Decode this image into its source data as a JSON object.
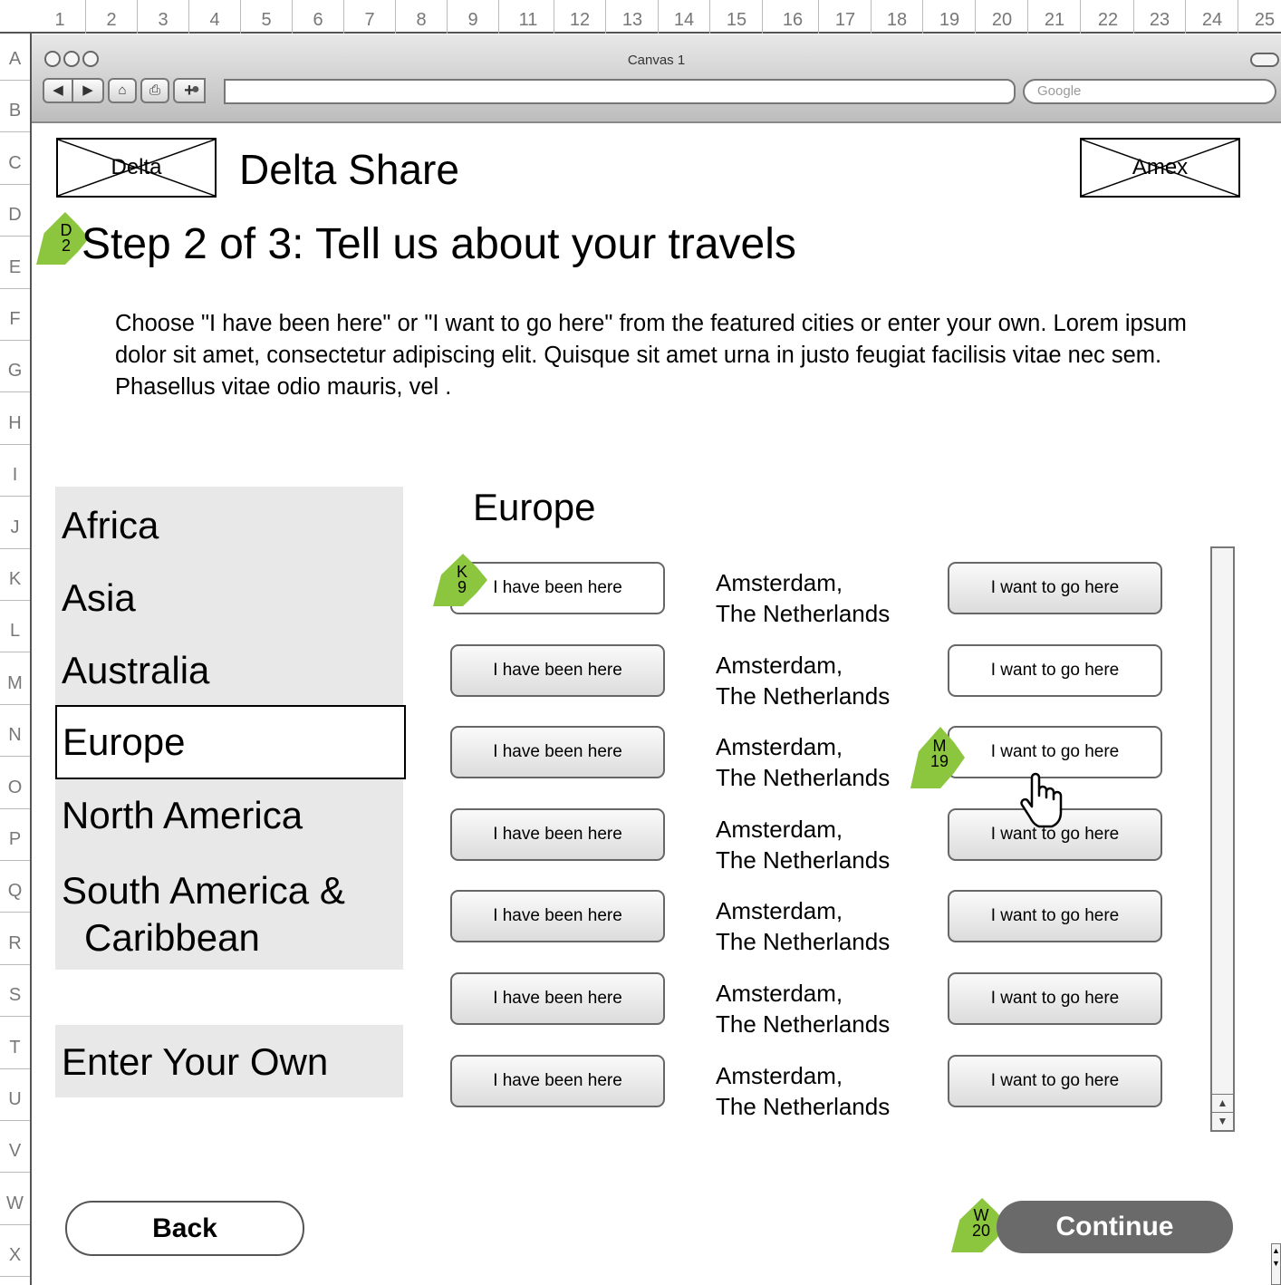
{
  "ruler": {
    "columns": [
      "1",
      "2",
      "3",
      "4",
      "5",
      "6",
      "7",
      "8",
      "9",
      "11",
      "12",
      "13",
      "14",
      "15",
      "16",
      "17",
      "18",
      "19",
      "20",
      "21",
      "22",
      "23",
      "24",
      "25"
    ],
    "rows": [
      "A",
      "B",
      "C",
      "D",
      "E",
      "F",
      "G",
      "H",
      "I",
      "J",
      "K",
      "L",
      "M",
      "N",
      "O",
      "P",
      "Q",
      "R",
      "S",
      "T",
      "U",
      "V",
      "W",
      "X"
    ]
  },
  "window": {
    "title": "Canvas 1",
    "search_placeholder": "Google",
    "nav": {
      "back_glyph": "◀",
      "forward_glyph": "▶",
      "home_glyph": "⌂",
      "print_glyph": "⎙",
      "add_glyph": "+",
      "globe_glyph": "●"
    }
  },
  "header": {
    "left_logo": "Delta",
    "site_title": "Delta Share",
    "right_logo": "Amex"
  },
  "step": {
    "marker": [
      "D",
      "2"
    ],
    "title": "Step 2 of 3: Tell us about your travels",
    "intro": "Choose \"I have been here\" or \"I want to go here\" from the featured cities or enter your own. Lorem ipsum dolor sit amet, consectetur adipiscing elit. Quisque sit amet urna in justo feugiat facilisis vitae nec sem. Phasellus vitae odio mauris, vel ."
  },
  "regions": {
    "items": [
      "Africa",
      "Asia",
      "Australia",
      "Europe",
      "North America",
      "South America &",
      "Caribbean"
    ],
    "selected": "Europe",
    "enter_own": "Enter Your Own"
  },
  "cities": {
    "section_title": "Europe",
    "been_label": "I have been here",
    "want_label": "I want to go here",
    "rows": [
      {
        "city": "Amsterdam,",
        "country": "The Netherlands"
      },
      {
        "city": "Amsterdam,",
        "country": "The Netherlands"
      },
      {
        "city": "Amsterdam,",
        "country": "The Netherlands"
      },
      {
        "city": "Amsterdam,",
        "country": "The Netherlands"
      },
      {
        "city": "Amsterdam,",
        "country": "The Netherlands"
      },
      {
        "city": "Amsterdam,",
        "country": "The Netherlands"
      },
      {
        "city": "Amsterdam,",
        "country": "The Netherlands"
      }
    ]
  },
  "markers": {
    "k9": [
      "K",
      "9"
    ],
    "m19": [
      "M",
      "19"
    ],
    "w20": [
      "W",
      "20"
    ]
  },
  "footer": {
    "back_label": "Back",
    "continue_label": "Continue"
  },
  "colors": {
    "annotation_leaf": "#8cc63f",
    "panel_bg": "#e8e8e8",
    "continue_bg": "#6a6a6a"
  }
}
